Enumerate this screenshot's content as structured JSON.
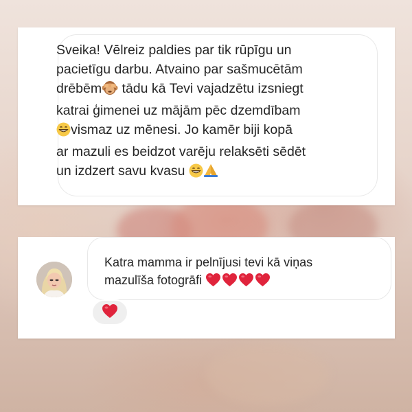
{
  "message_1": {
    "lines": [
      "Sveika! Vēlreiz paldies par tik rūpīgu un",
      "pacietīgu darbu. Atvaino par sašmucētām",
      "drēbēm",
      " tādu kā Tevi vajadzētu izsniegt",
      "katrai ģimenei uz mājām pēc dzemdībam",
      "vismaz uz mēnesi. Jo kamēr biji kopā",
      "ar mazuli es beidzot varēju relaksēti sēdēt",
      "un izdzert savu kvasu "
    ],
    "emojis": [
      "see-no-evil-monkey-icon",
      "grinning-face-icon",
      "grinning-face-icon",
      "folded-hands-icon"
    ]
  },
  "message_2": {
    "lines": [
      "Katra mamma ir pelnījusi tevi kā viņas",
      "mazulīša fotogrāfi "
    ],
    "emojis": [
      "red-heart-icon",
      "red-heart-icon",
      "red-heart-icon",
      "red-heart-icon"
    ]
  },
  "reaction": {
    "emoji": "red-heart-icon"
  },
  "colors": {
    "text": "#262626",
    "bubble_border": "#e8e8e8",
    "heart": "#e0243c",
    "emoji_yellow": "#f7c948"
  }
}
